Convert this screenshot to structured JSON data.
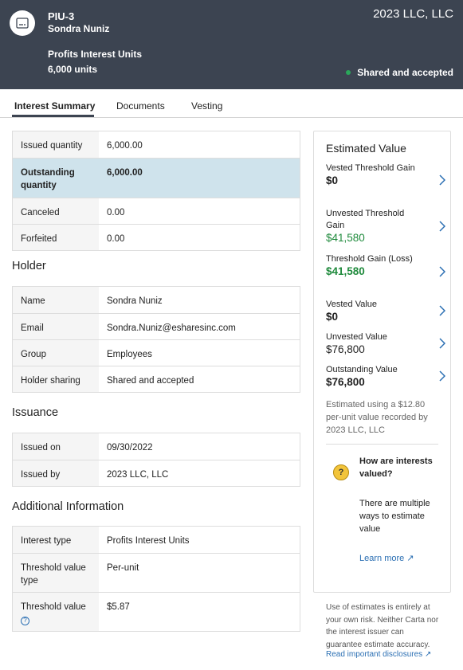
{
  "header": {
    "id": "PIU-3",
    "holder": "Sondra Nuniz",
    "company": "2023 LLC, LLC",
    "security_type": "Profits Interest Units",
    "units": "6,000 units",
    "status": "Shared and accepted",
    "status_color": "#2aa85a",
    "background": "#3c4451"
  },
  "tabs": [
    {
      "label": "Interest Summary",
      "active": true
    },
    {
      "label": "Documents",
      "active": false
    },
    {
      "label": "Vesting",
      "active": false
    }
  ],
  "summary": {
    "rows": [
      {
        "key": "Issued quantity",
        "value": "6,000.00"
      },
      {
        "key": "Outstanding quantity",
        "value": "6,000.00"
      },
      {
        "key": "Canceled",
        "value": "0.00"
      },
      {
        "key": "Forfeited",
        "value": "0.00"
      }
    ]
  },
  "holder": {
    "title": "Holder",
    "rows": [
      {
        "key": "Name",
        "value": "Sondra Nuniz"
      },
      {
        "key": "Email",
        "value": "Sondra.Nuniz@esharesinc.com"
      },
      {
        "key": "Group",
        "value": "Employees"
      },
      {
        "key": "Holder sharing",
        "value": "Shared and accepted"
      }
    ]
  },
  "issuance": {
    "title": "Issuance",
    "rows": [
      {
        "key": "Issued on",
        "value": "09/30/2022"
      },
      {
        "key": "Issued by",
        "value": "2023 LLC, LLC"
      }
    ]
  },
  "additional": {
    "title": "Additional Information",
    "rows": [
      {
        "key": "Interest type",
        "value": "Profits Interest Units"
      },
      {
        "key": "Threshold value type",
        "value": "Per-unit"
      },
      {
        "key": "Threshold value",
        "value": "$5.87"
      }
    ]
  },
  "estimated_value": {
    "title": "Estimated Value",
    "items": [
      {
        "label": "Vested Threshold Gain",
        "value": "$0"
      },
      {
        "label": "Unvested Threshold Gain",
        "value": "$41,580"
      },
      {
        "label": "Threshold Gain (Loss)",
        "value": "$41,580"
      },
      {
        "label": "Vested Value",
        "value": "$0"
      },
      {
        "label": "Unvested Value",
        "value": "$76,800"
      },
      {
        "label": "Outstanding Value",
        "value": "$76,800"
      }
    ],
    "note": "Estimated using a $12.80 per-unit value recorded by 2023 LLC, LLC",
    "help_title": "How are interests valued?",
    "help_body": "There are multiple ways to estimate value",
    "learn_more": "Learn more ↗",
    "green": "#1f8a3c",
    "link_color": "#2b6fb3"
  },
  "disclaimer": {
    "text": "Use of estimates is entirely at your own risk. Neither Carta nor the interest issuer can guarantee estimate accuracy.",
    "link": "Read important disclosures ↗"
  }
}
